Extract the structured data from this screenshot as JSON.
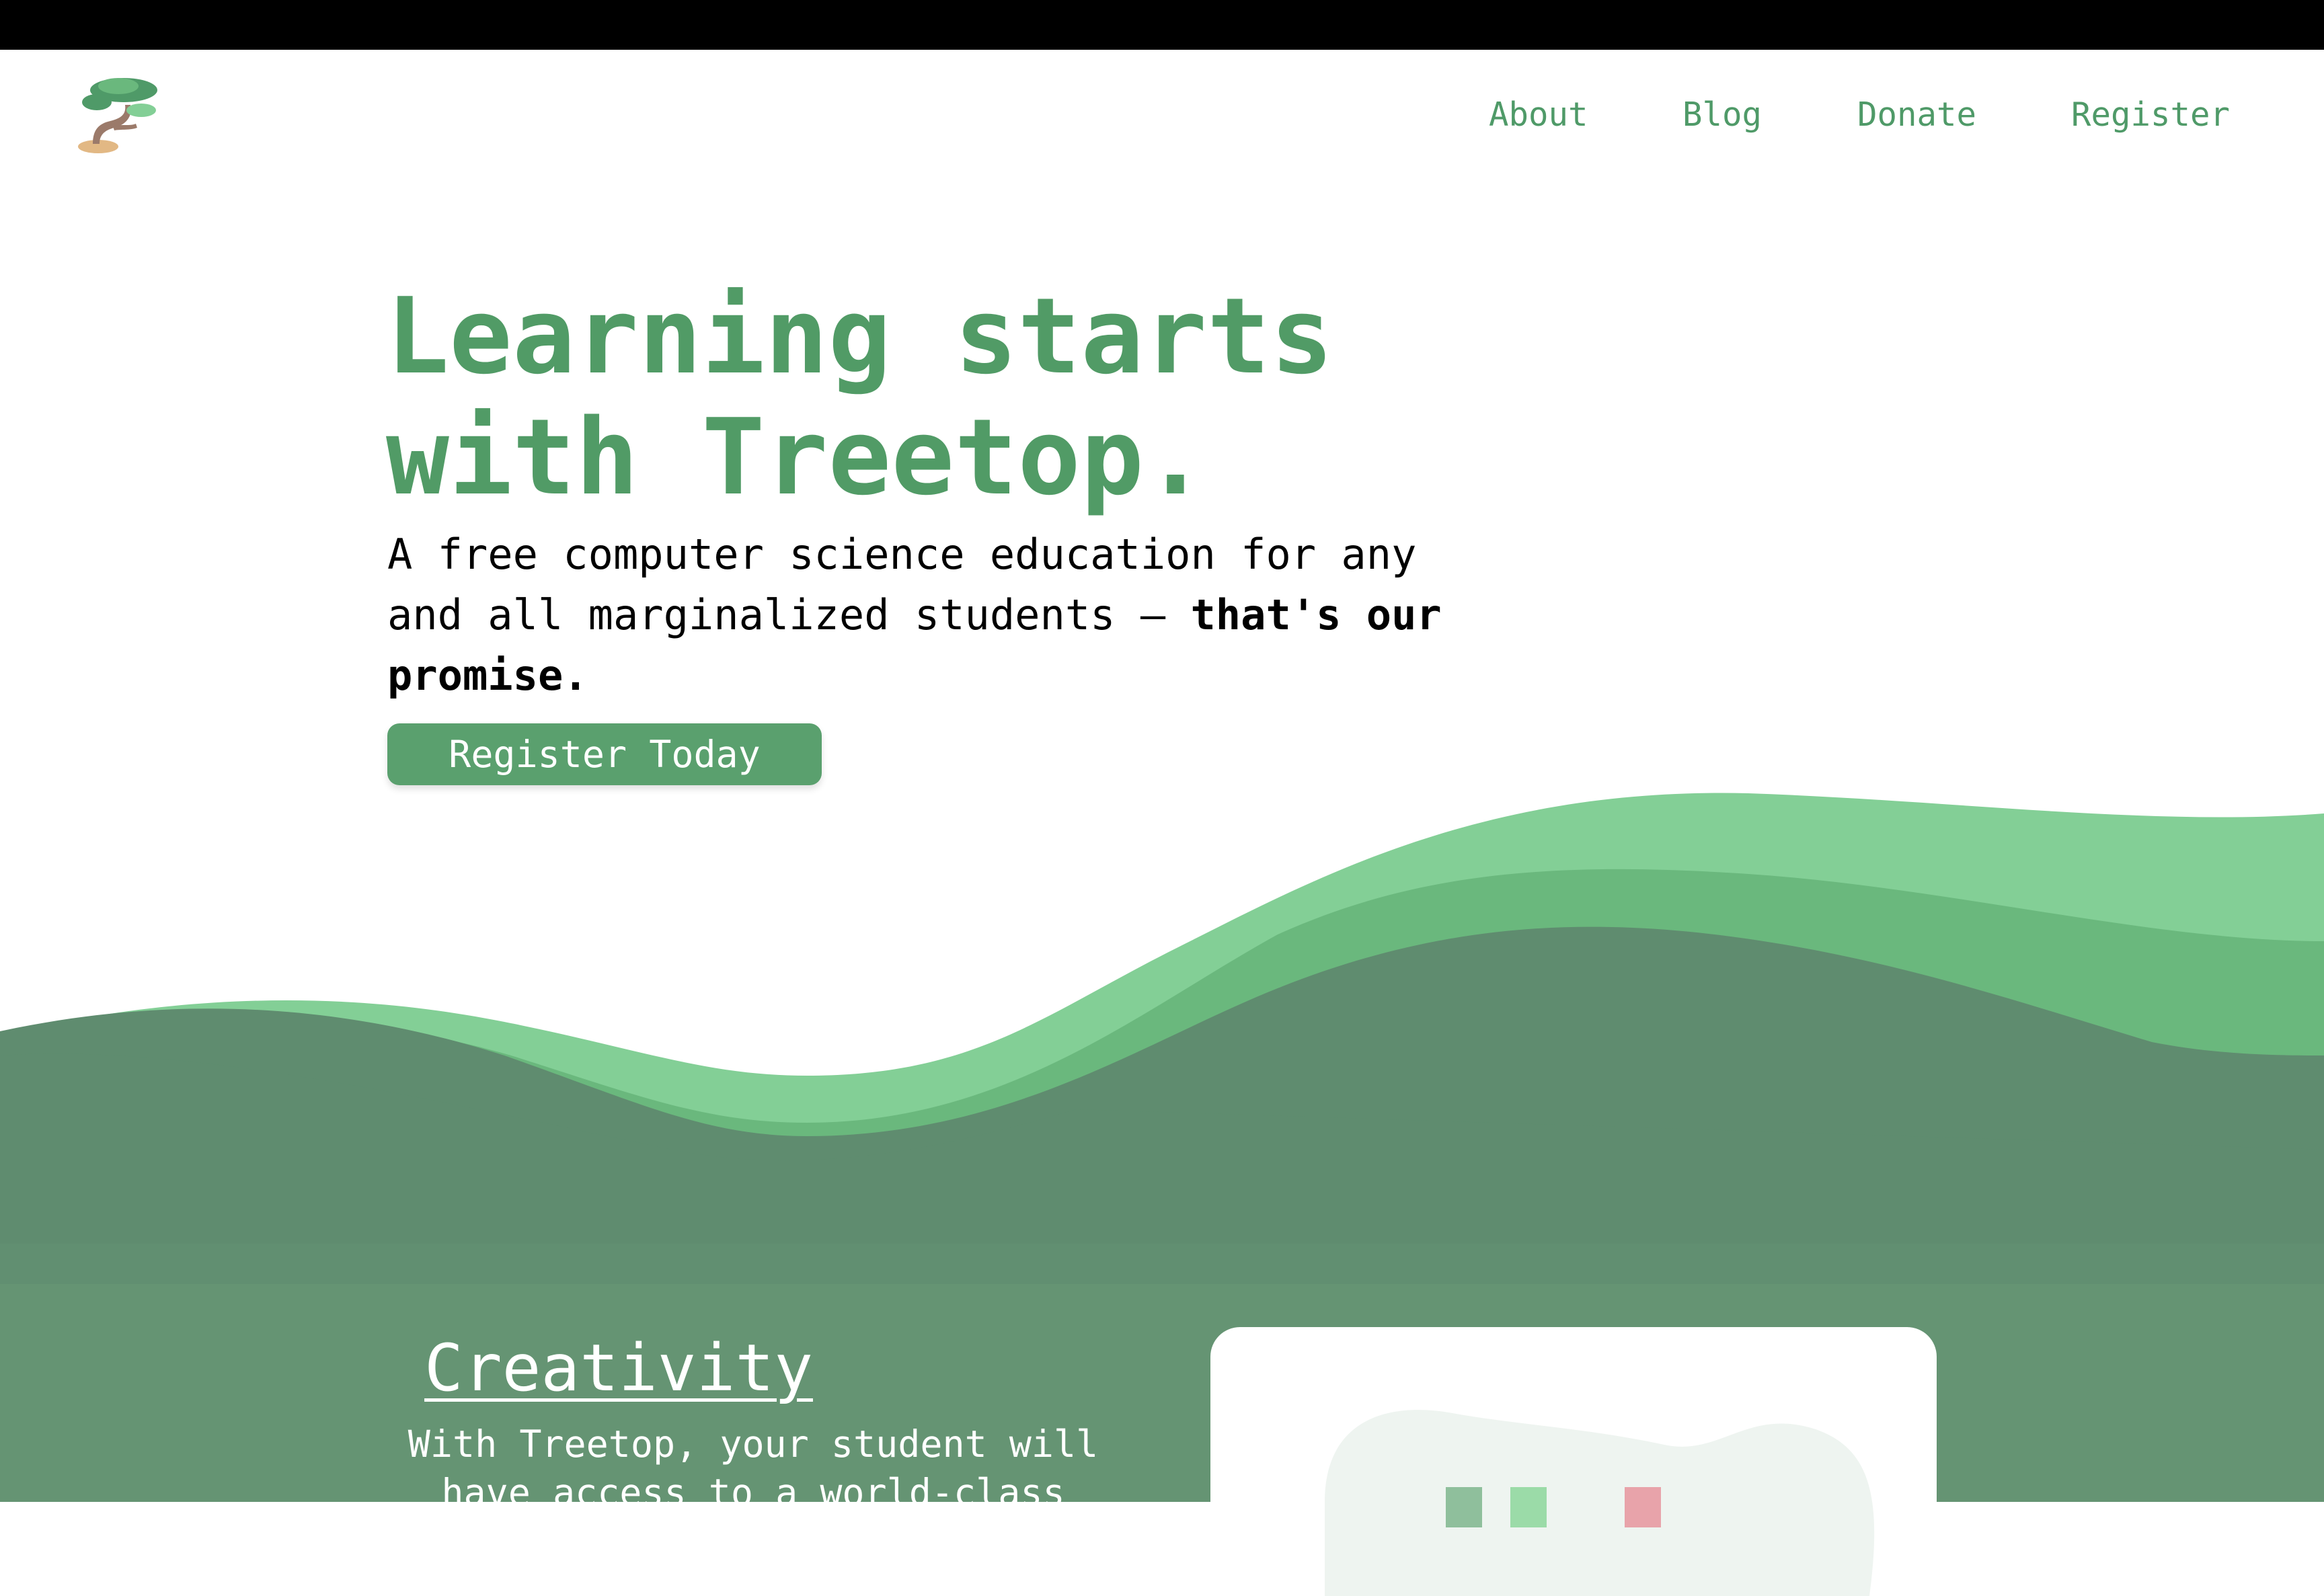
{
  "nav": {
    "links": [
      "About",
      "Blog",
      "Donate",
      "Register"
    ]
  },
  "hero": {
    "title_line1": "Learning starts",
    "title_line2": "with Treetop.",
    "subtitle_line1": "A free computer science education for any",
    "subtitle_line2_plain": "and all marginalized students – ",
    "subtitle_line2_bold": "that's our",
    "subtitle_line3_bold": "promise.",
    "cta_label": "Register Today"
  },
  "feature": {
    "title": "Creativity",
    "text_line1": "With Treetop, your student will",
    "text_line2": "have access to a world-class"
  },
  "icons": {
    "logo": "bonsai-tree-icon"
  },
  "colors": {
    "brand_green": "#519b66",
    "button_green": "#5aa06e",
    "wave_light": "#83cf96",
    "wave_mid": "#6ab87d",
    "wave_dark": "#5f8c6f",
    "section_bg": "#659473"
  }
}
